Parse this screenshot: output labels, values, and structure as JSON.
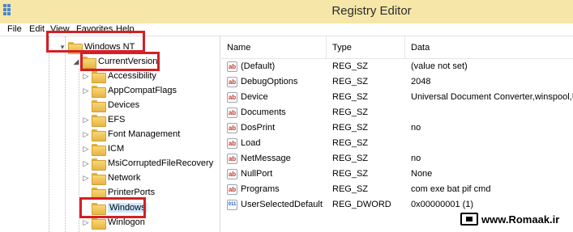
{
  "window": {
    "title": "Registry Editor",
    "icon": "registry-editor-icon"
  },
  "menu": [
    "File",
    "Edit",
    "View",
    "Favorites",
    "Help"
  ],
  "tree": {
    "nodes": [
      {
        "label": "Windows NT",
        "expander": "▾",
        "selected": false
      },
      {
        "label": "CurrentVersion",
        "expander": "◢",
        "selected": false
      },
      {
        "label": "Accessibility",
        "expander": "▷",
        "selected": false
      },
      {
        "label": "AppCompatFlags",
        "expander": "▷",
        "selected": false
      },
      {
        "label": "Devices",
        "expander": "",
        "selected": false
      },
      {
        "label": "EFS",
        "expander": "▷",
        "selected": false
      },
      {
        "label": "Font Management",
        "expander": "▷",
        "selected": false
      },
      {
        "label": "ICM",
        "expander": "▷",
        "selected": false
      },
      {
        "label": "MsiCorruptedFileRecovery",
        "expander": "▷",
        "selected": false
      },
      {
        "label": "Network",
        "expander": "▷",
        "selected": false
      },
      {
        "label": "PrinterPorts",
        "expander": "",
        "selected": false
      },
      {
        "label": "Windows",
        "expander": "",
        "selected": true
      },
      {
        "label": "Winlogon",
        "expander": "▷",
        "selected": false
      }
    ]
  },
  "columns": {
    "name": "Name",
    "type": "Type",
    "data": "Data"
  },
  "values": [
    {
      "icon": "ab",
      "name": "(Default)",
      "type": "REG_SZ",
      "data": "(value not set)"
    },
    {
      "icon": "ab",
      "name": "DebugOptions",
      "type": "REG_SZ",
      "data": "2048"
    },
    {
      "icon": "ab",
      "name": "Device",
      "type": "REG_SZ",
      "data": "Universal Document Converter,winspool,UDC"
    },
    {
      "icon": "ab",
      "name": "Documents",
      "type": "REG_SZ",
      "data": ""
    },
    {
      "icon": "ab",
      "name": "DosPrint",
      "type": "REG_SZ",
      "data": "no"
    },
    {
      "icon": "ab",
      "name": "Load",
      "type": "REG_SZ",
      "data": ""
    },
    {
      "icon": "ab",
      "name": "NetMessage",
      "type": "REG_SZ",
      "data": "no"
    },
    {
      "icon": "ab",
      "name": "NullPort",
      "type": "REG_SZ",
      "data": "None"
    },
    {
      "icon": "ab",
      "name": "Programs",
      "type": "REG_SZ",
      "data": "com exe bat pif cmd"
    },
    {
      "icon": "011",
      "name": "UserSelectedDefault",
      "type": "REG_DWORD",
      "data": "0x00000001 (1)"
    }
  ],
  "watermark": {
    "text": "www.Romaak.ir",
    "icon": "monitor-icon"
  },
  "colors": {
    "titlebar": "#f6e6a8",
    "highlight": "#d41f26",
    "selection": "#cde8ff"
  }
}
